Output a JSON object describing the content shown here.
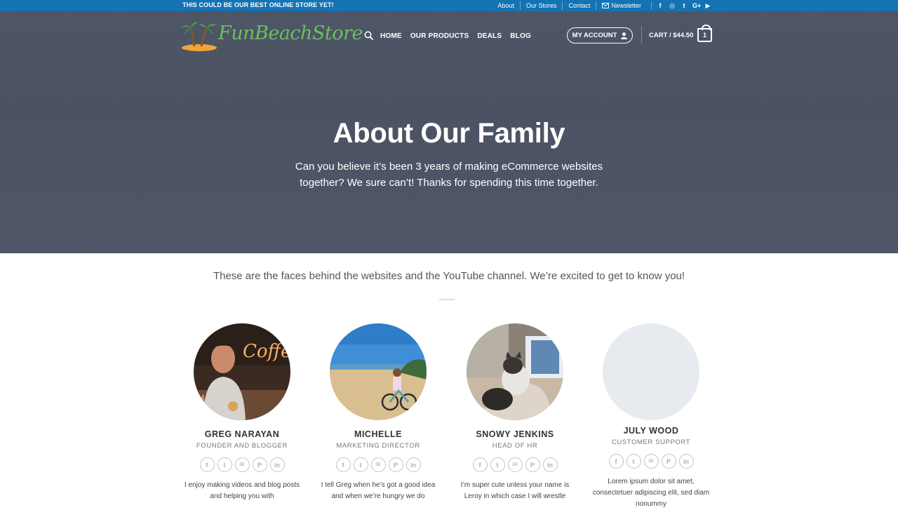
{
  "topbar": {
    "promo": "THIS COULD BE OUR BEST ONLINE STORE YET!",
    "links": [
      "About",
      "Our Stores",
      "Contact",
      "Newsletter"
    ],
    "social_icons": [
      "facebook-icon",
      "instagram-icon",
      "twitter-icon",
      "google-plus-icon",
      "youtube-icon"
    ],
    "social_glyphs": [
      "f",
      "◎",
      "t",
      "G+",
      "▶"
    ]
  },
  "header": {
    "logo_text": "FunBeachStore",
    "nav": [
      "HOME",
      "OUR PRODUCTS",
      "DEALS",
      "BLOG"
    ],
    "account_label": "MY ACCOUNT",
    "cart_label": "CART / $44.50",
    "cart_count": "1"
  },
  "hero": {
    "title": "About Our Family",
    "subtitle": "Can you believe it’s been 3 years of making eCommerce websites together? We sure can’t! Thanks for spending this time together."
  },
  "intro": "These are the faces behind the websites and the YouTube channel. We’re excited to get to know you!",
  "team": [
    {
      "name": "GREG NARAYAN",
      "role": "FOUNDER AND BLOGGER",
      "bio": "I enjoy making videos and blog posts and helping you with"
    },
    {
      "name": "MICHELLE",
      "role": "MARKETING DIRECTOR",
      "bio": "I tell Greg when he’s got a good idea and when we’re hungry we do"
    },
    {
      "name": "SNOWY JENKINS",
      "role": "HEAD OF HR",
      "bio": "I’m super cute unless your name is Leroy in which case I will wrestle"
    },
    {
      "name": "JULY WOOD",
      "role": "CUSTOMER SUPPORT",
      "bio": "Lorem ipsum dolor sit amet, consectetuer adipiscing elit, sed diam nonummy"
    }
  ],
  "member_socials": [
    "facebook-icon",
    "twitter-icon",
    "email-icon",
    "pinterest-icon",
    "linkedin-icon"
  ],
  "member_social_glyphs": [
    "f",
    "t",
    "✉",
    "P",
    "in"
  ],
  "colors": {
    "topbar": "#1473b3",
    "hero": "#4d5566",
    "logo_green": "#6abf5e"
  }
}
